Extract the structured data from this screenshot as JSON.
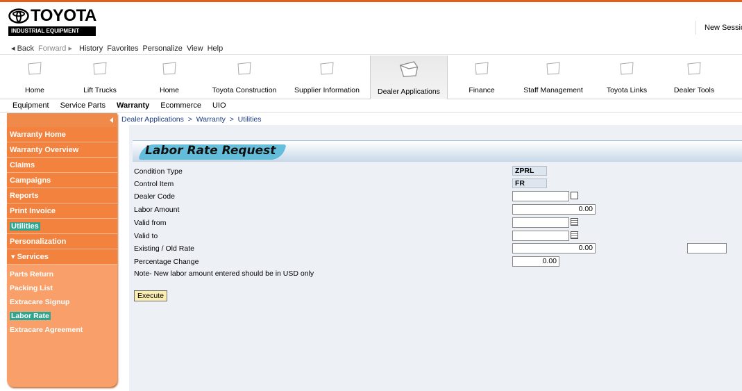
{
  "brand": {
    "name": "TOYOTA",
    "sub": "INDUSTRIAL EQUIPMENT"
  },
  "header": {
    "session": "New Session"
  },
  "menubar": {
    "back": "◂ Back",
    "forward": "Forward ▸",
    "items": [
      "History",
      "Favorites",
      "Personalize",
      "View",
      "Help"
    ]
  },
  "nav_tabs": [
    "Home",
    "Lift Trucks",
    "Home",
    "Toyota Construction",
    "Supplier Information",
    "Dealer Applications",
    "Finance",
    "Staff Management",
    "Toyota Links",
    "Dealer Tools"
  ],
  "sub_tabs": [
    "Equipment",
    "Service Parts",
    "Warranty",
    "Ecommerce",
    "UIO"
  ],
  "sidebar": {
    "items": [
      "Warranty Home",
      "Warranty Overview",
      "Claims",
      "Campaigns",
      "Reports",
      "Print Invoice",
      "Utilities",
      "Personalization"
    ],
    "services_label": "▾ Services",
    "services": [
      "Parts Return",
      "Packing List",
      "Extracare Signup",
      "Labor Rate",
      "Extracare Agreement"
    ]
  },
  "breadcrumb": "Dealer Applications  >  Warranty  >  Utilities",
  "form": {
    "title": "Labor Rate Request",
    "condition_type_label": "Condition Type",
    "condition_type_value": "ZPRL",
    "control_item_label": "Control Item",
    "control_item_value": "FR",
    "dealer_code_label": "Dealer Code",
    "dealer_code_value": "",
    "labor_amount_label": "Labor Amount",
    "labor_amount_value": "0.00",
    "valid_from_label": "Valid from",
    "valid_from_value": "",
    "valid_to_label": "Valid to",
    "valid_to_value": "",
    "existing_rate_label": "Existing / Old Rate",
    "existing_rate_value": "0.00",
    "existing_rate_extra": "",
    "percentage_change_label": "Percentage Change",
    "percentage_change_value": "0.00",
    "note": "Note- New labor amount entered should be in USD only",
    "execute_label": "Execute"
  },
  "colors": {
    "accent_orange": "#f4823f",
    "highlight_teal": "#2ea58f",
    "panel_blue": "#c7d8e8"
  }
}
